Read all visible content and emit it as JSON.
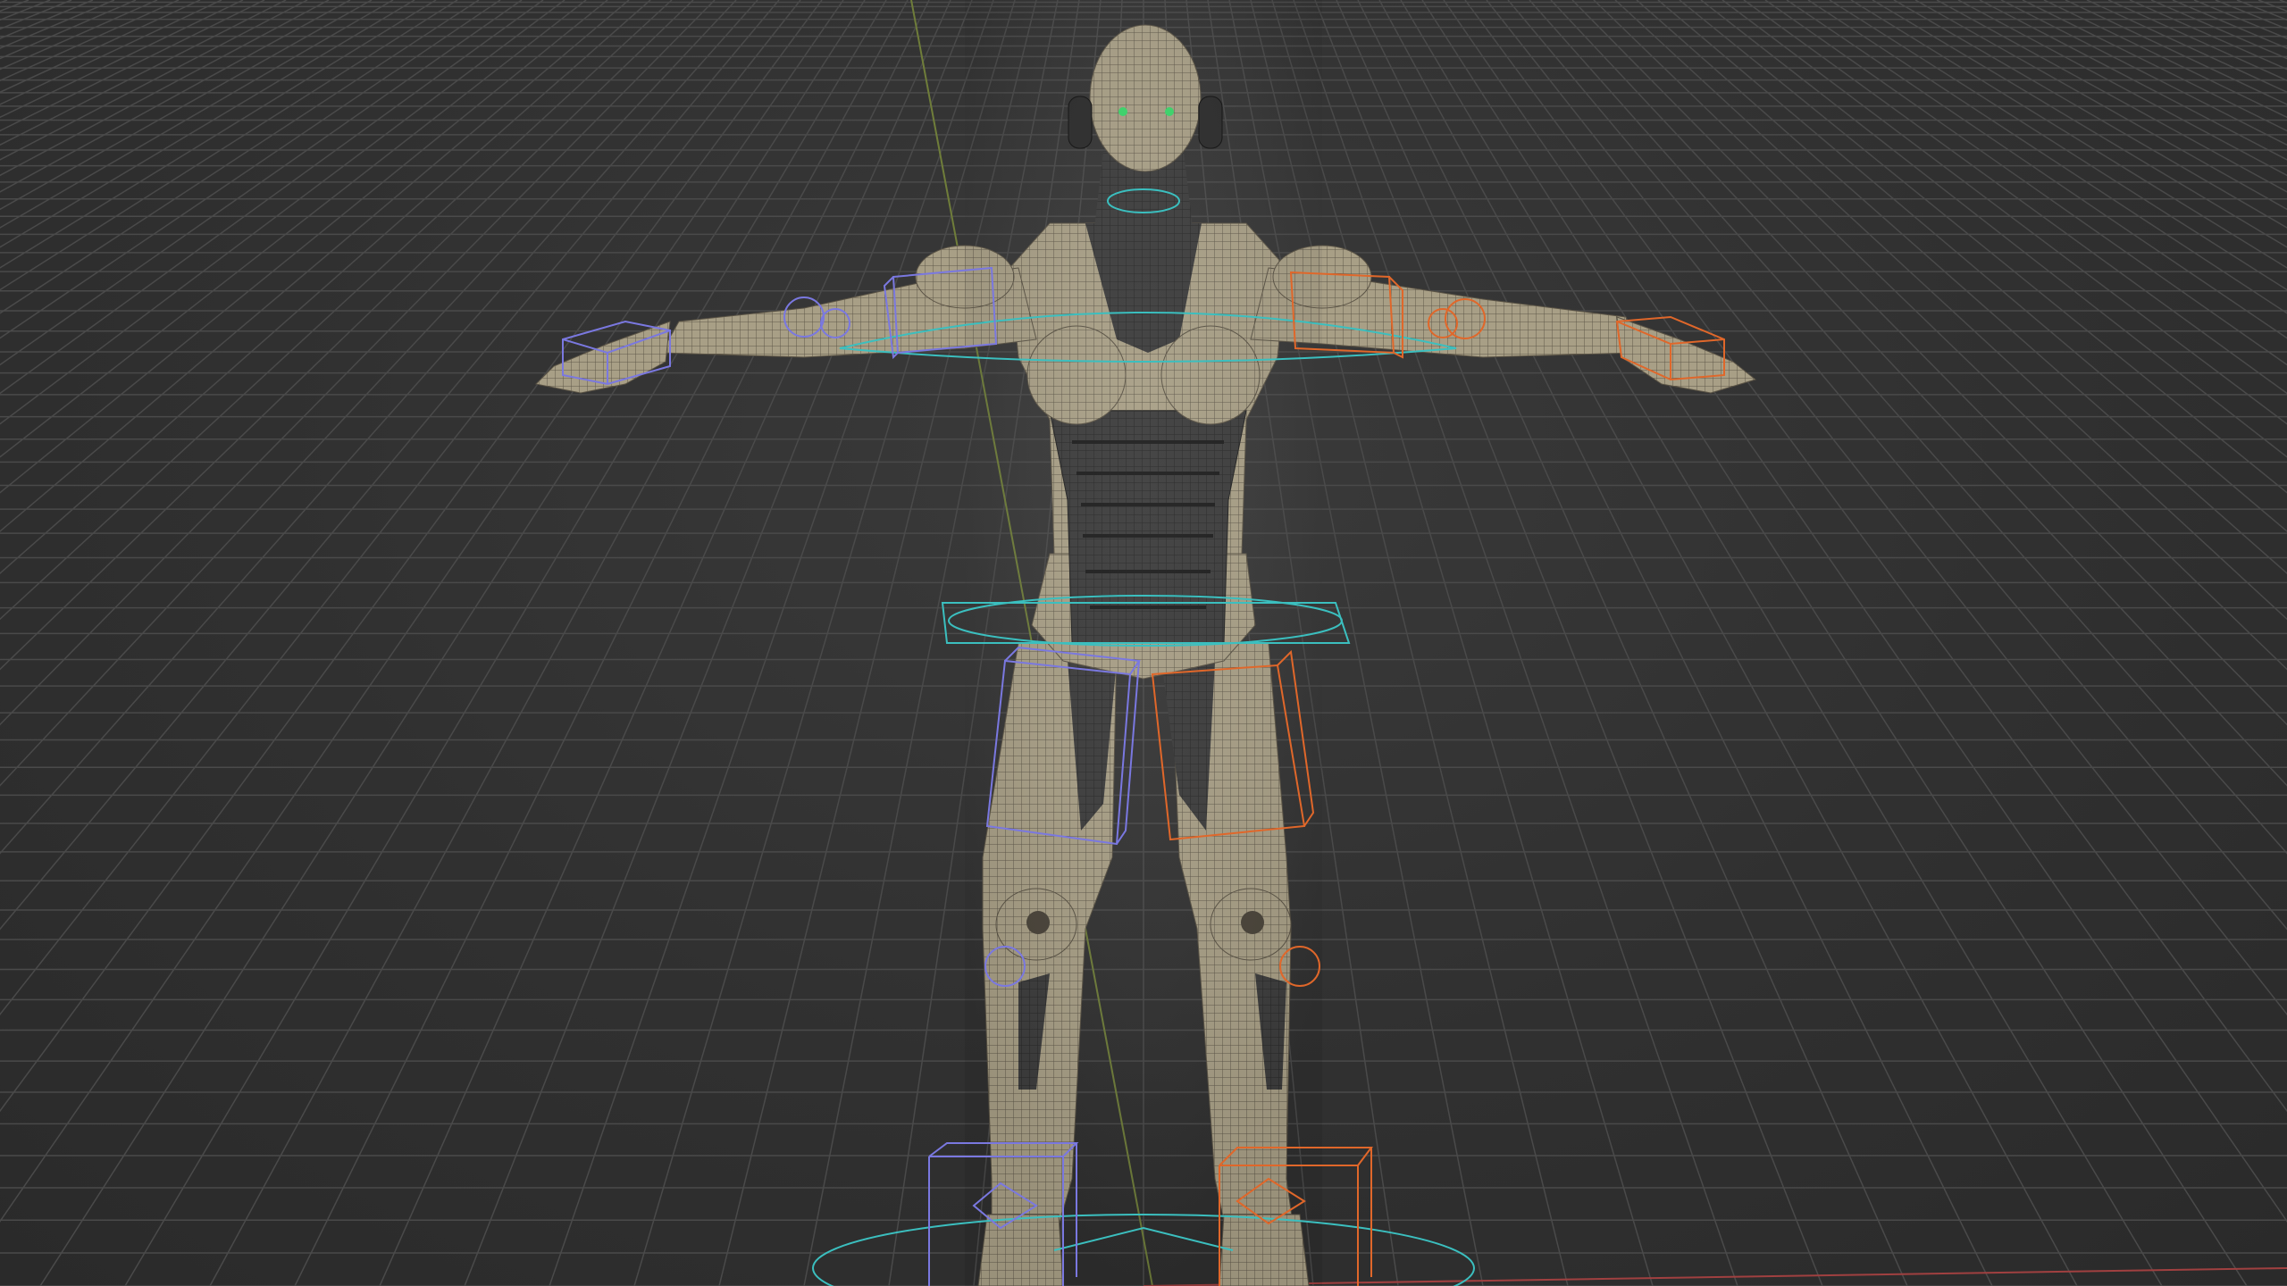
{
  "viewport": {
    "background": "#303030",
    "grid_color": "#4a4a4a",
    "x_axis_color": "#b04848",
    "y_axis_color": "#7a8a3a"
  },
  "model": {
    "mesh_color": "#a09880",
    "mesh_dark": "#3a3a3a",
    "eye_color": "#3ad66a"
  },
  "rig": {
    "left_controls_color": "#7a78e0",
    "right_controls_color": "#e0672a",
    "center_controls_color": "#3bbfbf"
  }
}
